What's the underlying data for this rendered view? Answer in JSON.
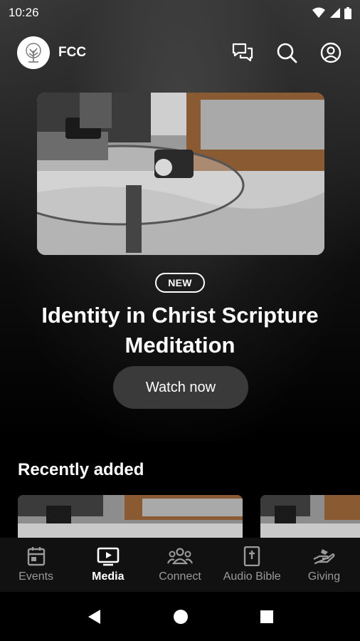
{
  "status_bar": {
    "time": "10:26"
  },
  "header": {
    "brand": "FCC"
  },
  "hero": {
    "badge": "NEW",
    "title": "Identity in Christ Scripture Meditation",
    "cta": "Watch now"
  },
  "recent": {
    "title": "Recently added"
  },
  "nav": {
    "items": [
      {
        "label": "Events",
        "icon": "calendar-icon",
        "active": false
      },
      {
        "label": "Media",
        "icon": "tv-play-icon",
        "active": true
      },
      {
        "label": "Connect",
        "icon": "group-icon",
        "active": false
      },
      {
        "label": "Audio Bible",
        "icon": "bible-icon",
        "active": false
      },
      {
        "label": "Giving",
        "icon": "giving-hand-icon",
        "active": false
      }
    ]
  },
  "colors": {
    "background": "#000000",
    "nav_background": "#111111",
    "button": "#3a3a3a",
    "inactive": "#9a9a9a"
  }
}
